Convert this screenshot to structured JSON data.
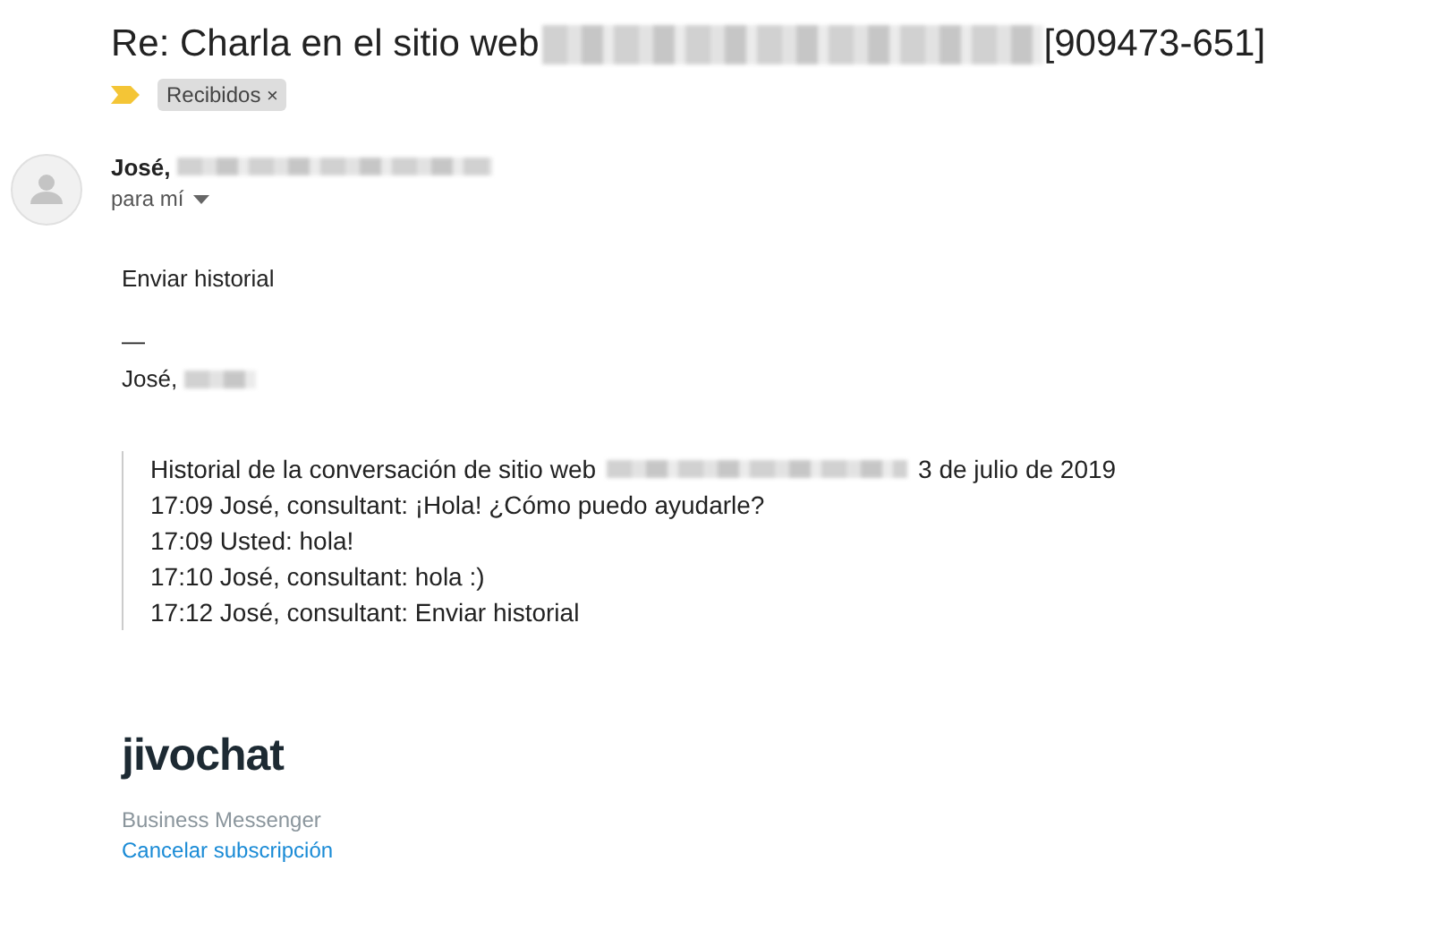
{
  "subject": {
    "title": "Re: Charla en el sitio web",
    "ticket": "[909473-651]"
  },
  "labels": [
    {
      "text": "Recibidos",
      "remove": "×"
    }
  ],
  "sender": {
    "name": "José,",
    "recipient": "para mí"
  },
  "body": {
    "message": "Enviar historial",
    "signature_rule": "—",
    "signature": "José,"
  },
  "history": {
    "heading": "Historial de la conversación de sitio web",
    "date": "3 de julio de 2019",
    "lines": [
      "17:09 José, consultant: ¡Hola! ¿Cómo puedo ayudarle?",
      "17:09 Usted: hola!",
      "17:10 José, consultant: hola :)",
      "17:12 José, consultant: Enviar historial"
    ]
  },
  "footer": {
    "logo": "jivochat",
    "tagline": "Business Messenger",
    "unsubscribe": "Cancelar subscripción"
  }
}
